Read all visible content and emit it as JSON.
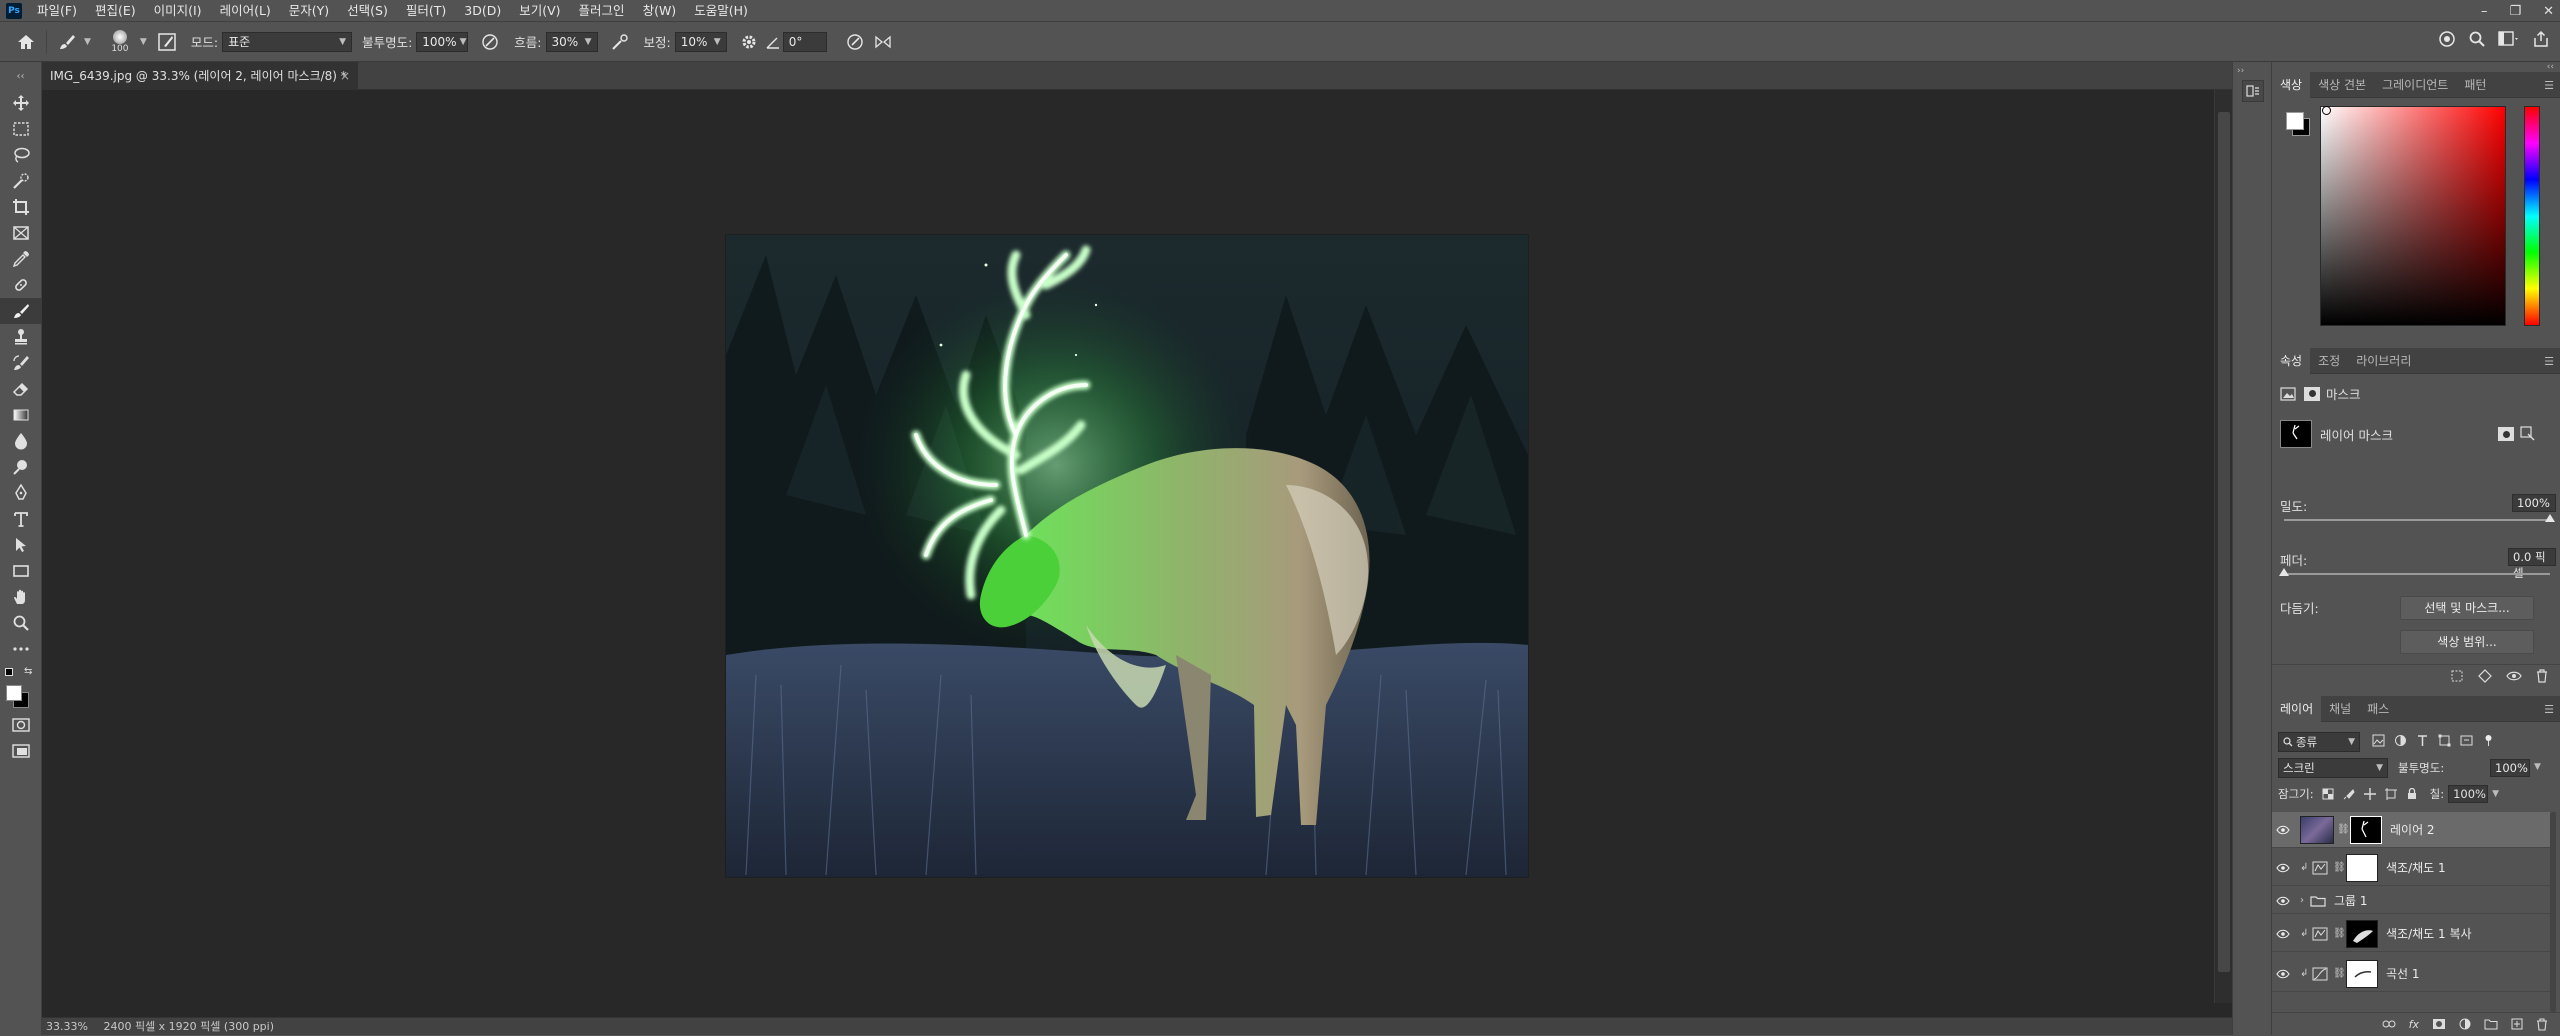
{
  "menu": {
    "logo": "Ps",
    "items": [
      "파일(F)",
      "편집(E)",
      "이미지(I)",
      "레이어(L)",
      "문자(Y)",
      "선택(S)",
      "필터(T)",
      "3D(D)",
      "보기(V)",
      "플러그인",
      "창(W)",
      "도움말(H)"
    ]
  },
  "window_controls": [
    "–",
    "❐",
    "✕"
  ],
  "options": {
    "brush_size": "100",
    "mode_label": "모드:",
    "mode_value": "표준",
    "opacity_label": "불투명도:",
    "opacity_value": "100%",
    "flow_label": "흐름:",
    "flow_value": "30%",
    "smoothing_label": "보정:",
    "smoothing_value": "10%",
    "angle_value": "0°"
  },
  "document": {
    "tab_title": "IMG_6439.jpg @ 33.3% (레이어 2, 레이어 마스크/8) *",
    "tab_close": "×",
    "status_zoom": "33.33%",
    "status_info": "2400 픽셀 x 1920 픽셀 (300 ppi)"
  },
  "color_panel": {
    "tabs": [
      "색상",
      "색상 견본",
      "그레이디언트",
      "패턴"
    ],
    "active_tab": 0,
    "foreground": "#ffffff",
    "background": "#000000",
    "hue_color": "#ff0000"
  },
  "properties_panel": {
    "tabs": [
      "속성",
      "조정",
      "라이브러리"
    ],
    "active_tab": 0,
    "section_title": "마스크",
    "mask_label": "레이어 마스크",
    "density_label": "밀도:",
    "density_value": "100%",
    "density_level": 1.0,
    "feather_label": "페더:",
    "feather_value": "0.0 픽셀",
    "feather_level": 0.0,
    "refine_label": "다듬기:",
    "btn_select_mask": "선택 및 마스크...",
    "btn_color_range": "색상 범위..."
  },
  "layers_panel": {
    "tabs": [
      "레이어",
      "채널",
      "패스"
    ],
    "active_tab": 0,
    "filter_kind": "종류",
    "blend_mode": "스크린",
    "opacity_label": "불투명도:",
    "opacity_value": "100%",
    "lock_label": "잠그기:",
    "fill_label": "칠:",
    "fill_value": "100%",
    "layers": [
      {
        "name": "레이어 2",
        "type": "image-with-mask",
        "selected": true
      },
      {
        "name": "색조/채도 1",
        "type": "adjustment",
        "selected": false
      },
      {
        "name": "그룹 1",
        "type": "group",
        "selected": false
      },
      {
        "name": "색조/채도 1 복사",
        "type": "adjustment",
        "selected": false
      },
      {
        "name": "곡선 1",
        "type": "curves",
        "selected": false
      }
    ],
    "bottom_icons": [
      "link-icon",
      "fx-icon",
      "mask-icon",
      "adjustment-icon",
      "folder-icon",
      "new-layer-icon",
      "trash-icon"
    ]
  }
}
